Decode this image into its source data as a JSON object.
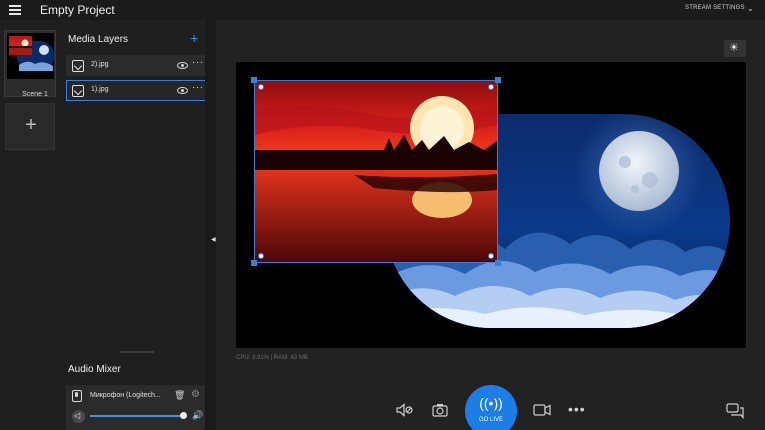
{
  "app": {
    "title": "Empty Project",
    "stream_settings": "STREAM SETTINGS"
  },
  "scenes": {
    "items": [
      {
        "label": "Scene 1"
      }
    ],
    "add_label": "+"
  },
  "media_layers": {
    "title": "Media Layers",
    "add_label": "+",
    "items": [
      {
        "name": "2).jpg",
        "selected": false
      },
      {
        "name": "1).jpg",
        "selected": true
      }
    ]
  },
  "audio_mixer": {
    "title": "Audio Mixer",
    "device": {
      "name": "Микрофон (Logitech...",
      "volume": 0.95,
      "muted": false
    }
  },
  "stage": {
    "stats": "CPU: 3.91% | RAM: 63 MB"
  },
  "toolbar": {
    "go_live": "GO LIVE"
  },
  "icons": {
    "menu": "hamburger-icon",
    "brightness": "sun-icon",
    "mic_mute": "mic-mute-icon",
    "snapshot": "camera-icon",
    "broadcast": "broadcast-icon",
    "video": "video-camera-icon",
    "more": "more-icon",
    "chat": "chat-icon"
  },
  "colors": {
    "accent": "#1a7ee6",
    "selection": "#3c7fd8"
  }
}
